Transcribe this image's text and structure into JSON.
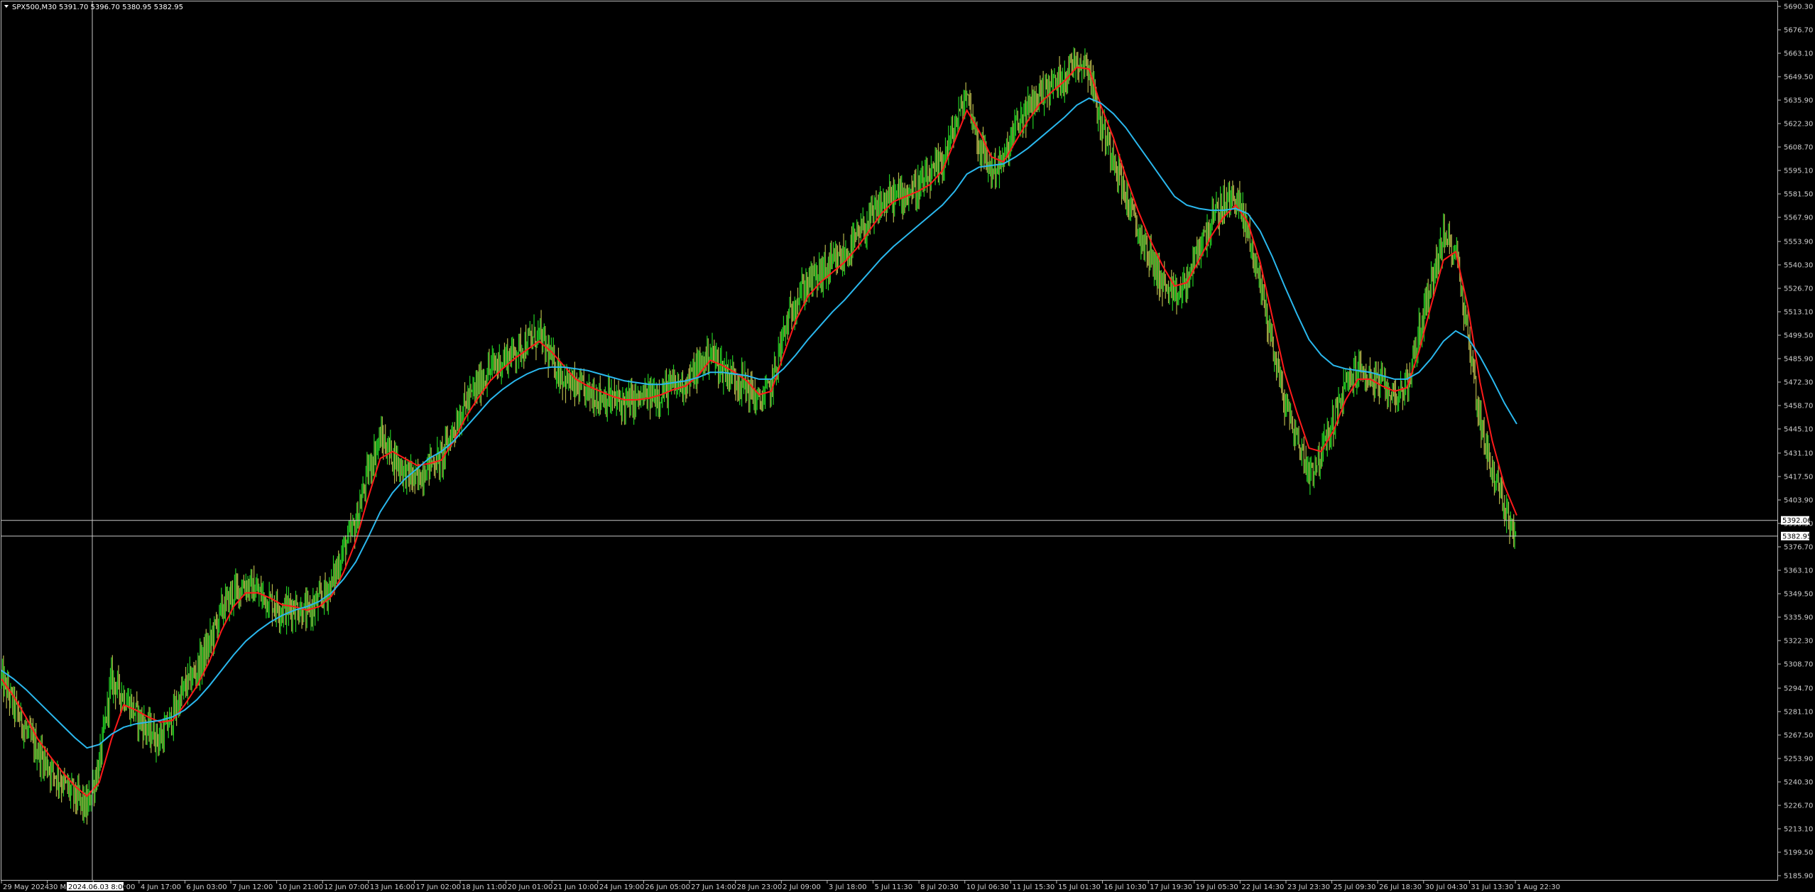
{
  "header": {
    "symbol_text": "SPX500,M30  5391.70 5396.70 5380.95 5382.95",
    "menu_triangle": "triangle-down-icon"
  },
  "colors": {
    "background": "#000000",
    "bull_candle": "#22cc22",
    "bear_candle": "#b5b54a",
    "ma_fast": "#ff1a1a",
    "ma_slow": "#2ab8ee",
    "crosshair": "#c8c8c8",
    "price_line": "#c8c8c8",
    "axis_text": "#d0d0d0"
  },
  "crosshair": {
    "price_label": "5392.06",
    "time_label": "2024.06.03 8:00"
  },
  "current_price_label": "5382.95",
  "chart_data": {
    "type": "line",
    "series": [
      {
        "key": "price",
        "values": [
          5300,
          5285,
          5270,
          5258,
          5248,
          5240,
          5232,
          5225,
          5250,
          5300,
          5290,
          5280,
          5270,
          5265,
          5278,
          5295,
          5305,
          5320,
          5340,
          5350,
          5355,
          5350,
          5345,
          5340,
          5342,
          5338,
          5345,
          5355,
          5375,
          5390,
          5420,
          5440,
          5430,
          5420,
          5415,
          5425,
          5428,
          5445,
          5460,
          5470,
          5480,
          5485,
          5490,
          5495,
          5500,
          5485,
          5475,
          5468,
          5466,
          5464,
          5462,
          5460,
          5462,
          5464,
          5466,
          5470,
          5472,
          5480,
          5490,
          5480,
          5475,
          5470,
          5460,
          5470,
          5500,
          5520,
          5530,
          5535,
          5540,
          5545,
          5555,
          5565,
          5575,
          5580,
          5582,
          5585,
          5590,
          5600,
          5620,
          5640,
          5610,
          5595,
          5600,
          5620,
          5630,
          5640,
          5645,
          5650,
          5660,
          5655,
          5620,
          5605,
          5580,
          5560,
          5545,
          5530,
          5520,
          5530,
          5550,
          5565,
          5575,
          5580,
          5560,
          5530,
          5495,
          5460,
          5440,
          5420,
          5430,
          5450,
          5470,
          5480,
          5475,
          5470,
          5465,
          5470,
          5500,
          5530,
          5555,
          5550,
          5500,
          5450,
          5420,
          5400,
          5382.95
        ]
      },
      {
        "key": "ma_fast",
        "values": [
          5300,
          5290,
          5278,
          5265,
          5255,
          5246,
          5238,
          5232,
          5240,
          5265,
          5285,
          5282,
          5278,
          5275,
          5276,
          5285,
          5296,
          5310,
          5328,
          5342,
          5350,
          5350,
          5347,
          5343,
          5342,
          5340,
          5342,
          5348,
          5362,
          5380,
          5405,
          5428,
          5432,
          5428,
          5424,
          5425,
          5427,
          5438,
          5452,
          5463,
          5473,
          5480,
          5486,
          5491,
          5496,
          5490,
          5482,
          5474,
          5470,
          5467,
          5464,
          5462,
          5462,
          5463,
          5465,
          5468,
          5470,
          5476,
          5485,
          5482,
          5478,
          5473,
          5465,
          5467,
          5488,
          5508,
          5522,
          5530,
          5536,
          5542,
          5550,
          5560,
          5570,
          5577,
          5580,
          5583,
          5587,
          5595,
          5612,
          5630,
          5618,
          5603,
          5600,
          5612,
          5624,
          5634,
          5641,
          5647,
          5655,
          5654,
          5632,
          5614,
          5592,
          5572,
          5555,
          5540,
          5528,
          5530,
          5543,
          5557,
          5568,
          5575,
          5565,
          5542,
          5510,
          5478,
          5455,
          5434,
          5432,
          5444,
          5462,
          5474,
          5474,
          5470,
          5467,
          5469,
          5490,
          5517,
          5543,
          5548,
          5516,
          5472,
          5438,
          5412,
          5395
        ]
      },
      {
        "key": "ma_slow",
        "values": [
          5305,
          5300,
          5294,
          5287,
          5280,
          5273,
          5266,
          5260,
          5262,
          5268,
          5272,
          5274,
          5275,
          5276,
          5278,
          5282,
          5288,
          5296,
          5305,
          5314,
          5322,
          5328,
          5333,
          5337,
          5340,
          5342,
          5345,
          5350,
          5358,
          5368,
          5382,
          5397,
          5408,
          5416,
          5422,
          5428,
          5432,
          5438,
          5446,
          5454,
          5462,
          5468,
          5473,
          5477,
          5480,
          5481,
          5481,
          5480,
          5479,
          5477,
          5475,
          5473,
          5472,
          5471,
          5471,
          5472,
          5473,
          5475,
          5478,
          5478,
          5477,
          5476,
          5474,
          5474,
          5480,
          5488,
          5497,
          5505,
          5513,
          5520,
          5528,
          5536,
          5544,
          5551,
          5557,
          5563,
          5569,
          5575,
          5583,
          5593,
          5597,
          5598,
          5599,
          5603,
          5608,
          5614,
          5620,
          5626,
          5633,
          5637,
          5634,
          5628,
          5620,
          5610,
          5600,
          5590,
          5580,
          5575,
          5573,
          5572,
          5572,
          5573,
          5570,
          5560,
          5545,
          5528,
          5512,
          5497,
          5488,
          5482,
          5480,
          5479,
          5478,
          5476,
          5474,
          5474,
          5478,
          5486,
          5496,
          5502,
          5498,
          5487,
          5474,
          5460,
          5448
        ]
      }
    ],
    "ylim": [
      5185.9,
      5690.3
    ],
    "y_ticks": [
      "5690.30",
      "5676.70",
      "5663.10",
      "5649.50",
      "5635.90",
      "5622.30",
      "5608.70",
      "5595.10",
      "5581.50",
      "5567.90",
      "5553.90",
      "5540.30",
      "5526.70",
      "5513.10",
      "5499.50",
      "5485.90",
      "5472.30",
      "5458.70",
      "5445.10",
      "5431.10",
      "5417.50",
      "5403.90",
      "5390.30",
      "5376.70",
      "5363.10",
      "5349.50",
      "5335.90",
      "5322.30",
      "5308.70",
      "5294.70",
      "5281.10",
      "5267.50",
      "5253.90",
      "5240.30",
      "5226.70",
      "5213.10",
      "5199.50",
      "5185.90"
    ],
    "x_ticks": [
      "29 May 2024",
      "30 May 2024",
      "3 Jun 08:00",
      "4 Jun 17:00",
      "6 Jun 03:00",
      "7 Jun 12:00",
      "10 Jun 21:00",
      "12 Jun 07:00",
      "13 Jun 16:00",
      "17 Jun 02:00",
      "18 Jun 11:00",
      "20 Jun 01:00",
      "21 Jun 10:00",
      "24 Jun 19:00",
      "26 Jun 05:00",
      "27 Jun 14:00",
      "28 Jun 23:00",
      "2 Jul 09:00",
      "3 Jul 18:00",
      "5 Jul 11:30",
      "8 Jul 20:30",
      "10 Jul 06:30",
      "11 Jul 15:30",
      "15 Jul 01:30",
      "16 Jul 10:30",
      "17 Jul 19:30",
      "19 Jul 05:30",
      "22 Jul 14:30",
      "23 Jul 23:30",
      "25 Jul 09:30",
      "26 Jul 18:30",
      "30 Jul 04:30",
      "31 Jul 13:30",
      "1 Aug 22:30"
    ],
    "grid": false,
    "legend": "none"
  }
}
